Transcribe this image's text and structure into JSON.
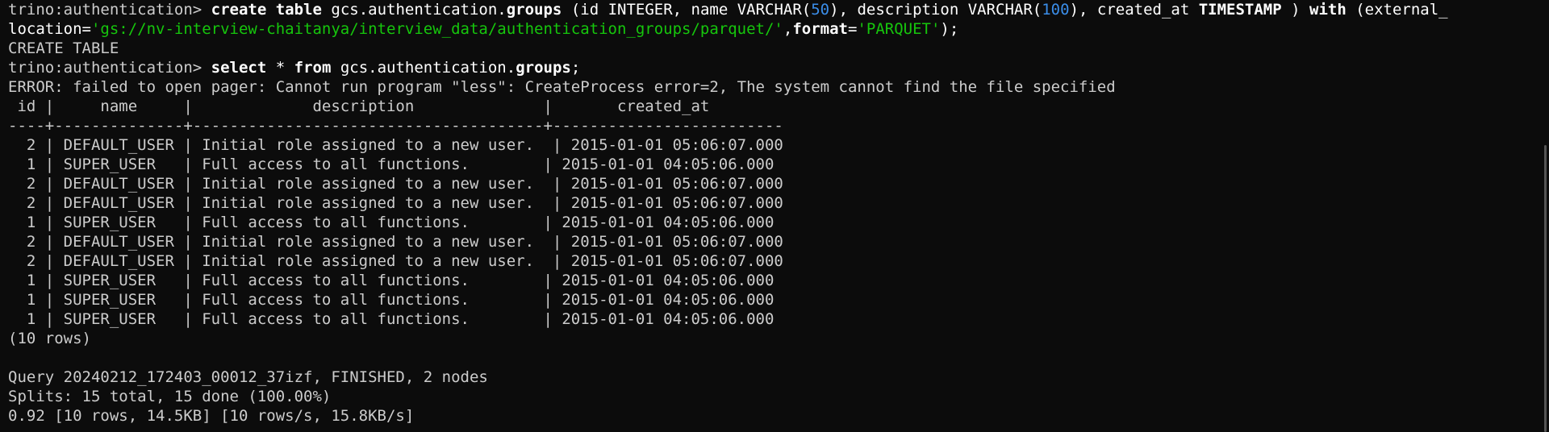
{
  "session": {
    "line1": {
      "prompt": "trino:authentication> ",
      "cmd_a": "create table",
      "cmd_b": " gcs.authentication.",
      "cmd_c": "groups",
      "cmd_d": " (id INTEGER, name VARCHAR(",
      "num1": "50",
      "cmd_e": "), description VARCHAR(",
      "num2": "100",
      "cmd_f": "), created_at ",
      "cmd_g": "TIMESTAMP",
      "cmd_h": " ) ",
      "cmd_i": "with",
      "cmd_j": " (external_"
    },
    "line2": {
      "a": "location=",
      "str": "'gs://nv-interview-chaitanya/interview_data/authentication_groups/parquet/'",
      "b": ",",
      "c": "format",
      "d": "=",
      "str2": "'PARQUET'",
      "e": ");"
    },
    "line3": "CREATE TABLE",
    "line4": {
      "prompt": "trino:authentication> ",
      "a": "select",
      "b": " * ",
      "c": "from",
      "d": " gcs.authentication.",
      "e": "groups",
      "f": ";"
    },
    "error": "ERROR: failed to open pager: Cannot run program \"less\": CreateProcess error=2, The system cannot find the file specified",
    "header": " id |     name     |             description              |       created_at",
    "separator": "----+--------------+--------------------------------------+-------------------------",
    "rows": [
      "  2 | DEFAULT_USER | Initial role assigned to a new user.  | 2015-01-01 05:06:07.000",
      "  1 | SUPER_USER   | Full access to all functions.        | 2015-01-01 04:05:06.000",
      "  2 | DEFAULT_USER | Initial role assigned to a new user.  | 2015-01-01 05:06:07.000",
      "  2 | DEFAULT_USER | Initial role assigned to a new user.  | 2015-01-01 05:06:07.000",
      "  1 | SUPER_USER   | Full access to all functions.        | 2015-01-01 04:05:06.000",
      "  2 | DEFAULT_USER | Initial role assigned to a new user.  | 2015-01-01 05:06:07.000",
      "  2 | DEFAULT_USER | Initial role assigned to a new user.  | 2015-01-01 05:06:07.000",
      "  1 | SUPER_USER   | Full access to all functions.        | 2015-01-01 04:05:06.000",
      "  1 | SUPER_USER   | Full access to all functions.        | 2015-01-01 04:05:06.000",
      "  1 | SUPER_USER   | Full access to all functions.        | 2015-01-01 04:05:06.000"
    ],
    "row_count": "(10 rows)",
    "query": "Query 20240212_172403_00012_37izf, FINISHED, 2 nodes",
    "splits": "Splits: 15 total, 15 done (100.00%)",
    "stats": "0.92 [10 rows, 14.5KB] [10 rows/s, 15.8KB/s]"
  }
}
